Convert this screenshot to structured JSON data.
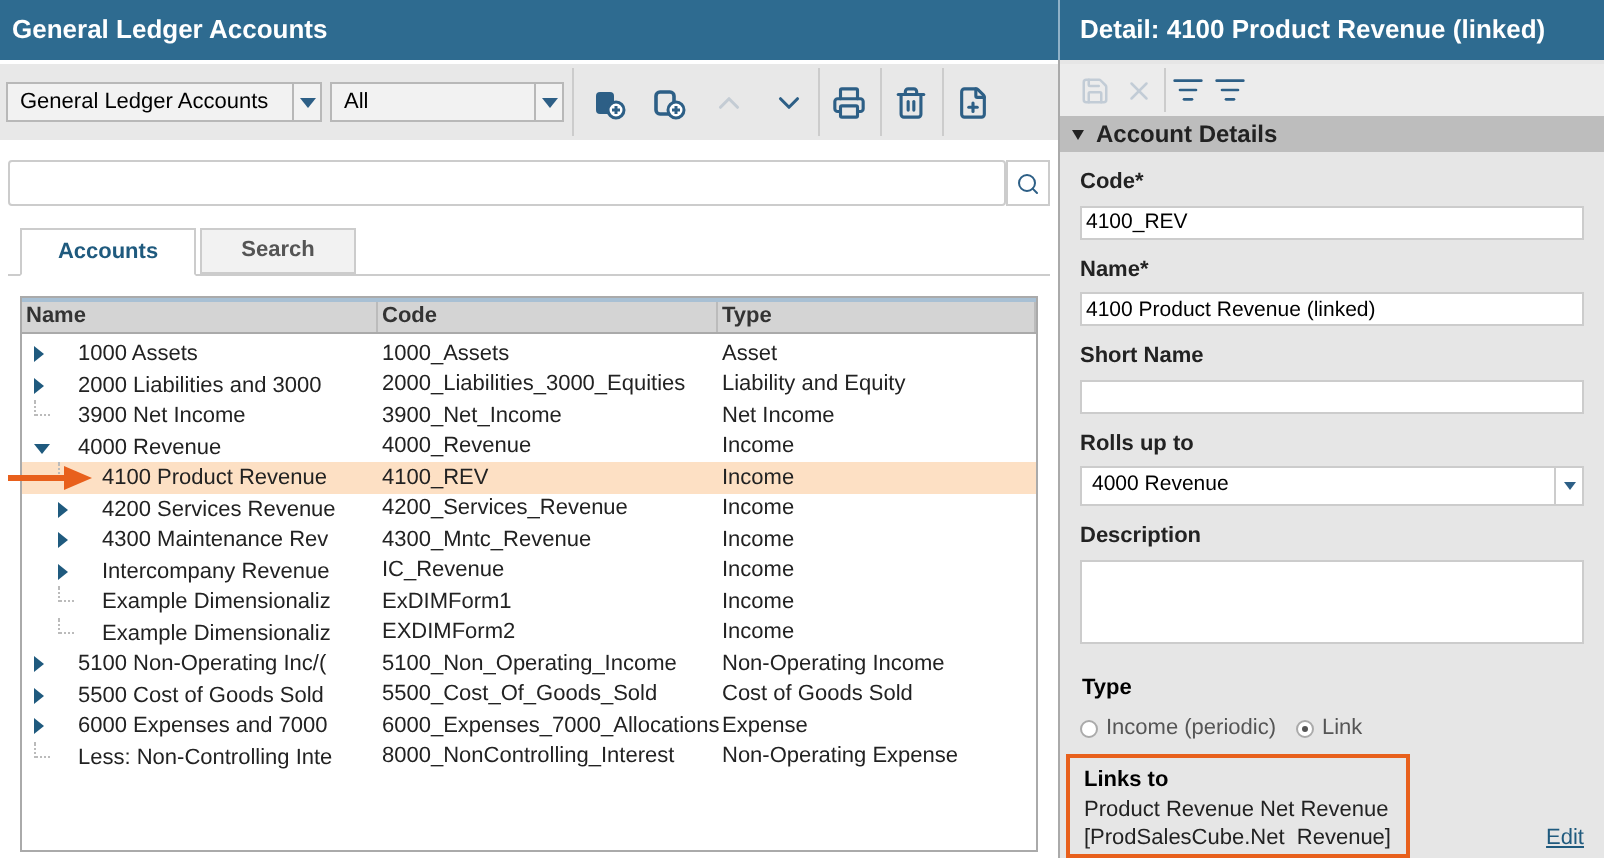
{
  "left_title": "General Ledger Accounts",
  "right_title": "Detail: 4100 Product Revenue (linked)",
  "toolbar": {
    "dropdowns": [
      "General Ledger Accounts",
      "All"
    ],
    "buttons": [
      {
        "disabled": false
      },
      {
        "disabled": false
      },
      {
        "disabled": true
      },
      {
        "disabled": false
      },
      {
        "disabled": false
      },
      {
        "disabled": false
      },
      {
        "disabled": false
      }
    ]
  },
  "tabs": [
    {
      "label": "Accounts",
      "selected": true
    },
    {
      "label": "Search",
      "selected": false
    }
  ],
  "table": {
    "columns": [
      "Name",
      "Code",
      "Type"
    ],
    "rows": [
      {
        "name": "1000 Assets",
        "code": "1000_Assets",
        "type": "Asset",
        "kind": "collapsed",
        "selected": false
      },
      {
        "name": "2000 Liabilities and 3000",
        "code": "2000_Liabilities_3000_Equities",
        "type": "Liability and Equity",
        "kind": "collapsed",
        "selected": false
      },
      {
        "name": "3900 Net Income",
        "code": "3900_Net_Income",
        "type": "Net Income",
        "kind": "leaf",
        "selected": false
      },
      {
        "name": "4000 Revenue",
        "code": "4000_Revenue",
        "type": "Income",
        "kind": "expanded",
        "selected": false,
        "children": [
          {
            "name": "4100 Product Revenue",
            "code": "4100_REV",
            "type": "Income",
            "kind": "leaf",
            "selected": true
          },
          {
            "name": "4200 Services Revenue",
            "code": "4200_Services_Revenue",
            "type": "Income",
            "kind": "collapsed",
            "selected": false
          },
          {
            "name": "4300 Maintenance Rev",
            "code": "4300_Mntc_Revenue",
            "type": "Income",
            "kind": "collapsed",
            "selected": false
          },
          {
            "name": "Intercompany Revenue",
            "code": "IC_Revenue",
            "type": "Income",
            "kind": "collapsed",
            "selected": false
          },
          {
            "name": "Example Dimensionaliz",
            "code": "ExDIMForm1",
            "type": "Income",
            "kind": "leaf",
            "selected": false
          },
          {
            "name": "Example Dimensionaliz",
            "code": "EXDIMForm2",
            "type": "Income",
            "kind": "leaf",
            "selected": false
          }
        ]
      },
      {
        "name": "5100 Non-Operating Inc/(",
        "code": "5100_Non_Operating_Income",
        "type": "Non-Operating Income",
        "kind": "collapsed",
        "selected": false
      },
      {
        "name": "5500 Cost of Goods Sold",
        "code": "5500_Cost_Of_Goods_Sold",
        "type": "Cost of Goods Sold",
        "kind": "collapsed",
        "selected": false
      },
      {
        "name": "6000 Expenses and 7000",
        "code": "6000_Expenses_7000_Allocations",
        "type": "Expense",
        "kind": "collapsed",
        "selected": false
      },
      {
        "name": "Less: Non-Controlling Inte",
        "code": "8000_NonControlling_Interest",
        "type": "Non-Operating Expense",
        "kind": "leaf",
        "selected": false
      }
    ]
  },
  "detail": {
    "toolbar": [
      {
        "disabled": true
      },
      {
        "disabled": true
      },
      {
        "disabled": false
      },
      {
        "disabled": false
      }
    ],
    "section": {
      "title": "Account Details",
      "expanded": true
    },
    "fields": [
      {
        "label": "Code*",
        "value": "4100_REV",
        "kind": "text"
      },
      {
        "label": "Name*",
        "value": "4100 Product Revenue (linked)",
        "kind": "text"
      },
      {
        "label": "Short Name",
        "kind": "text"
      },
      {
        "label": "Rolls up to",
        "value": "4000 Revenue",
        "kind": "select"
      },
      {
        "label": "Description",
        "kind": "textarea"
      }
    ],
    "type": {
      "label": "Type",
      "options": [
        {
          "label": "Income (periodic)",
          "selected": false
        },
        {
          "label": "Link",
          "selected": true
        }
      ]
    },
    "links_to": {
      "label": "Links to",
      "lines": [
        "Product Revenue Net Revenue",
        "[ProdSalesCube.Net  Revenue]"
      ]
    },
    "edit_link": "Edit"
  }
}
